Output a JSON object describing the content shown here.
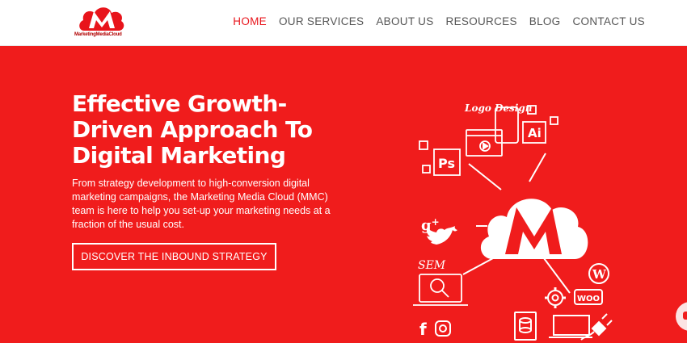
{
  "brand": {
    "logo_text": "MarketingMediaCloud",
    "primary_color": "#f01c1c",
    "logo_color": "#e8141b"
  },
  "nav": {
    "items": [
      {
        "label": "HOME",
        "active": true
      },
      {
        "label": "OUR SERVICES",
        "active": false
      },
      {
        "label": "ABOUT US",
        "active": false
      },
      {
        "label": "RESOURCES",
        "active": false
      },
      {
        "label": "BLOG",
        "active": false
      },
      {
        "label": "CONTACT US",
        "active": false
      }
    ]
  },
  "hero": {
    "headline_lines": [
      "Effective Growth-",
      "Driven Approach To",
      "Digital Marketing"
    ],
    "description": "From strategy development to high-conversion digital marketing campaigns, the Marketing Media Cloud (MMC) team is here to help you set-up your marketing needs at a fraction of the usual cost.",
    "cta_label": "DISCOVER THE INBOUND STRATEGY"
  },
  "illustration": {
    "logo_design_label": "Logo Design",
    "ai_label": "Ai",
    "ps_label": "Ps",
    "sem_label": "SEM",
    "woo_label": "WOO",
    "icons": [
      "monitor-icon",
      "phone-icon",
      "google-plus-icon",
      "twitter-icon",
      "facebook-icon",
      "instagram-icon",
      "wordpress-icon",
      "gear-icon",
      "plug-icon",
      "database-icon",
      "magnifier-icon"
    ]
  }
}
